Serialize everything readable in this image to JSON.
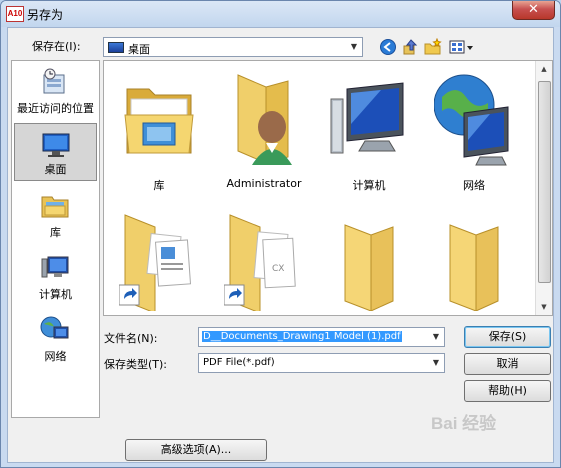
{
  "window": {
    "title": "另存为",
    "app_icon_text": "A10",
    "close_symbol": "✕"
  },
  "toolbar": {
    "save_in_label": "保存在(I):",
    "location": "桌面",
    "icons": [
      "back-icon",
      "up-folder-icon",
      "new-folder-icon",
      "view-menu-icon"
    ]
  },
  "places": [
    {
      "label": "最近访问的位置",
      "icon": "recent-places-icon",
      "selected": false
    },
    {
      "label": "桌面",
      "icon": "desktop-icon",
      "selected": true
    },
    {
      "label": "库",
      "icon": "library-icon",
      "selected": false
    },
    {
      "label": "计算机",
      "icon": "computer-icon",
      "selected": false
    },
    {
      "label": "网络",
      "icon": "network-icon",
      "selected": false
    }
  ],
  "files": [
    {
      "label": "库",
      "icon": "library-folder-icon"
    },
    {
      "label": "Administrator",
      "icon": "user-folder-icon"
    },
    {
      "label": "计算机",
      "icon": "computer-icon"
    },
    {
      "label": "网络",
      "icon": "network-icon"
    },
    {
      "label": "",
      "icon": "shortcut-folder-icon"
    },
    {
      "label": "",
      "icon": "shortcut-folder-icon"
    },
    {
      "label": "",
      "icon": "folder-icon"
    },
    {
      "label": "",
      "icon": "folder-icon"
    }
  ],
  "form": {
    "filename_label": "文件名(N):",
    "filename_value": "D__Documents_Drawing1 Model (1).pdf",
    "filetype_label": "保存类型(T):",
    "filetype_value": "PDF File(*.pdf)"
  },
  "buttons": {
    "save": "保存(S)",
    "cancel": "取消",
    "help": "帮助(H)",
    "advanced": "高级选项(A)..."
  },
  "watermark": "Bai 经验",
  "colors": {
    "selection": "#3399ff",
    "title_bar": "#c9daf0",
    "close_button": "#c75050"
  }
}
